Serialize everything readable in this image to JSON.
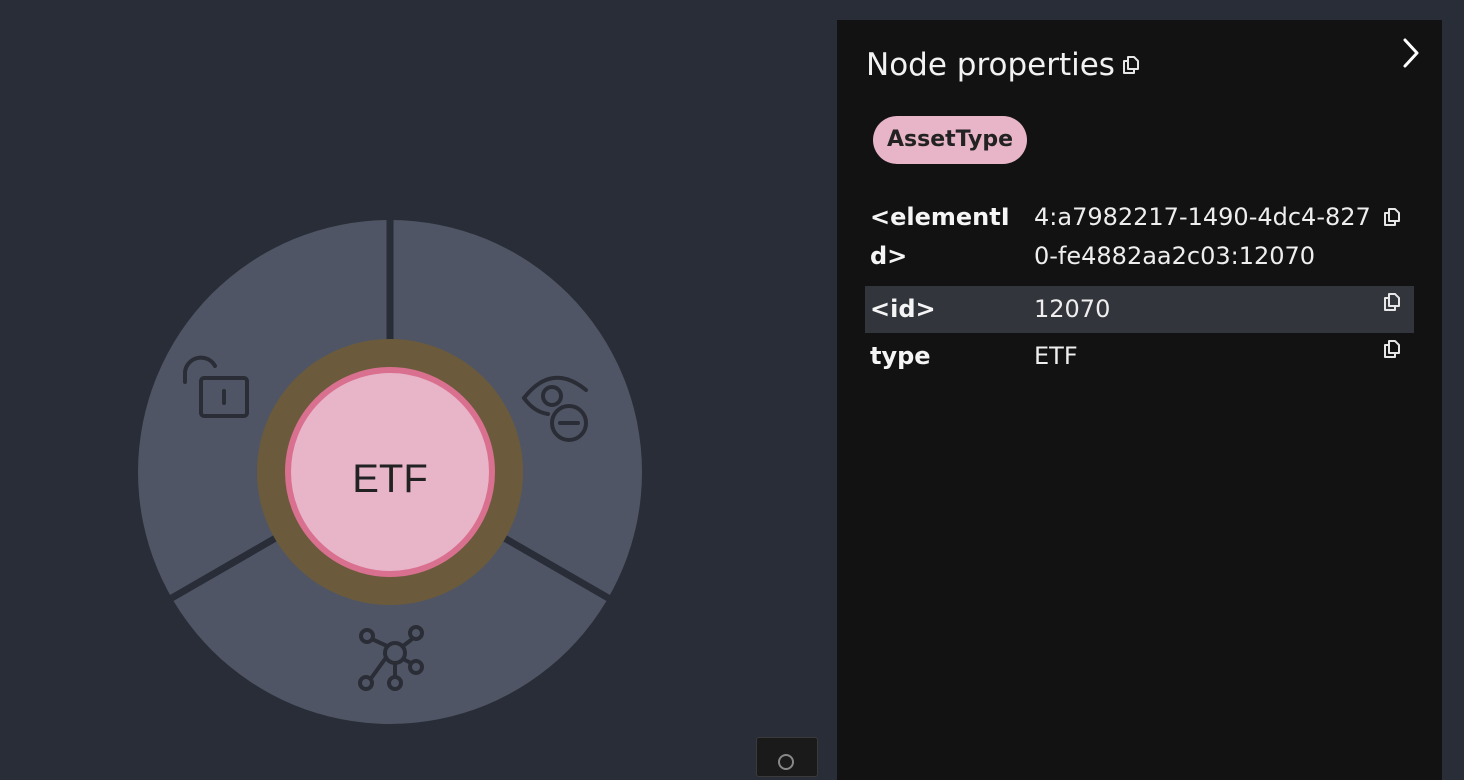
{
  "graph": {
    "node": {
      "caption": "ETF",
      "fill_color": "#e8b4c8",
      "border_color": "#d9708f",
      "selection_ring_color": "#6b5b3c"
    },
    "radial_menu": {
      "background": "#4f5565",
      "items": [
        {
          "action": "unlock",
          "icon": "unlocked-padlock-icon"
        },
        {
          "action": "dismiss",
          "icon": "eye-minus-icon"
        },
        {
          "action": "expand",
          "icon": "graph-network-icon"
        }
      ]
    }
  },
  "panel": {
    "title": "Node properties",
    "title_copy_icon": "copy-icon",
    "collapse_icon": "chevron-right-icon",
    "labels": [
      "AssetType"
    ],
    "label_color": "#e8b4c8",
    "properties": [
      {
        "key": "<elementId>",
        "value": "4:a7982217-1490-4dc4-8270-fe4882aa2c03:12070"
      },
      {
        "key": "<id>",
        "value": "12070"
      },
      {
        "key": "type",
        "value": "ETF"
      }
    ]
  }
}
